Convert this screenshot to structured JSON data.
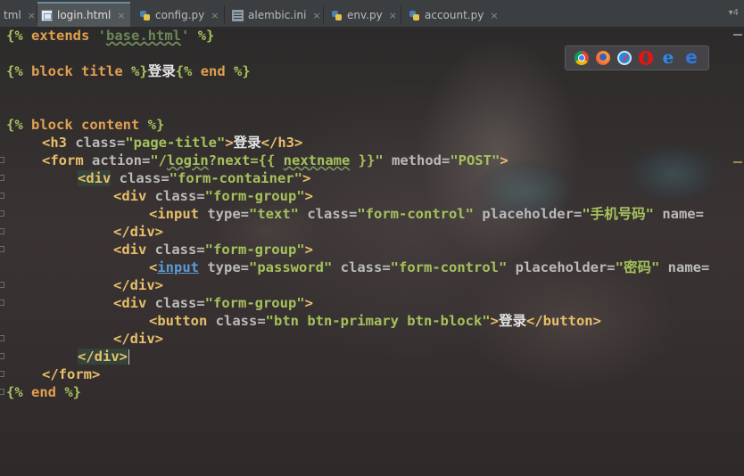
{
  "tabs": [
    {
      "label": "tml",
      "icon": "html-file-icon",
      "active": false
    },
    {
      "label": "login.html",
      "icon": "html-file-icon",
      "active": true
    },
    {
      "label": "config.py",
      "icon": "python-file-icon",
      "active": false
    },
    {
      "label": "alembic.ini",
      "icon": "ini-file-icon",
      "active": false
    },
    {
      "label": "env.py",
      "icon": "python-file-icon",
      "active": false
    },
    {
      "label": "account.py",
      "icon": "python-file-icon",
      "active": false
    }
  ],
  "close_glyph": "×",
  "tab_overflow": "▾4",
  "code": {
    "l1": {
      "open": "{% ",
      "kw": "extends",
      "sp": " ",
      "q1": "'",
      "val": "base.html",
      "q2": "'",
      "close": " %}"
    },
    "l3": {
      "open": "{% ",
      "kw1": "block",
      "sp1": " ",
      "kw2": "title",
      "close1": " %}",
      "text": "登录",
      "open2": "{% ",
      "kw3": "end",
      "close2": " %}"
    },
    "l6": {
      "open": "{% ",
      "kw1": "block",
      "sp1": " ",
      "kw2": "content",
      "close": " %}"
    },
    "l7": {
      "t1": "<h3",
      "a1": " class=",
      "s1": "\"page-title\"",
      "t2": ">",
      "text": "登录",
      "t3": "</h3>"
    },
    "l8": {
      "t1": "<form",
      "a1": " action=",
      "s1a": "\"/",
      "s1b": "login",
      "s1c": "?next={{ ",
      "s1d": "nextname",
      "s1e": " }}\"",
      "a2": " method=",
      "s2": "\"POST\"",
      "t2": ">"
    },
    "l9": {
      "t1": "<div",
      "a1": " class=",
      "s1": "\"form-container\"",
      "t2": ">"
    },
    "l10": {
      "t1": "<div",
      "a1": " class=",
      "s1": "\"form-group\"",
      "t2": ">"
    },
    "l11": {
      "t1": "<input",
      "a1": " type=",
      "s1": "\"text\"",
      "a2": " class=",
      "s2": "\"form-control\"",
      "a3": " placeholder=",
      "s3": "\"手机号码\"",
      "a4": " name="
    },
    "l12": {
      "t1": "</div>"
    },
    "l13": {
      "t1": "<div",
      "a1": " class=",
      "s1": "\"form-group\"",
      "t2": ">"
    },
    "l14": {
      "t0": "<",
      "t1": "input",
      "a1": " type=",
      "s1": "\"password\"",
      "a2": " class=",
      "s2": "\"form-control\"",
      "a3": " placeholder=",
      "s3": "\"密码\"",
      "a4": " name="
    },
    "l15": {
      "t1": "</div>"
    },
    "l16": {
      "t1": "<div",
      "a1": " class=",
      "s1": "\"form-group\"",
      "t2": ">"
    },
    "l17": {
      "t1": "<button",
      "a1": " class=",
      "s1": "\"btn btn-primary btn-block\"",
      "t2": ">",
      "text": "登录",
      "t3": "</button>"
    },
    "l18": {
      "t1": "</div>"
    },
    "l19": {
      "t1": "</div>"
    },
    "l20": {
      "t1": "</form>"
    },
    "l21": {
      "open": "{% ",
      "kw": "end",
      "close": " %}"
    }
  },
  "browser_icons": [
    "chrome-icon",
    "firefox-icon",
    "safari-icon",
    "opera-icon",
    "ie-icon",
    "edge-icon"
  ],
  "browser_glyphs": {
    "ie": "e",
    "edge": "e"
  }
}
